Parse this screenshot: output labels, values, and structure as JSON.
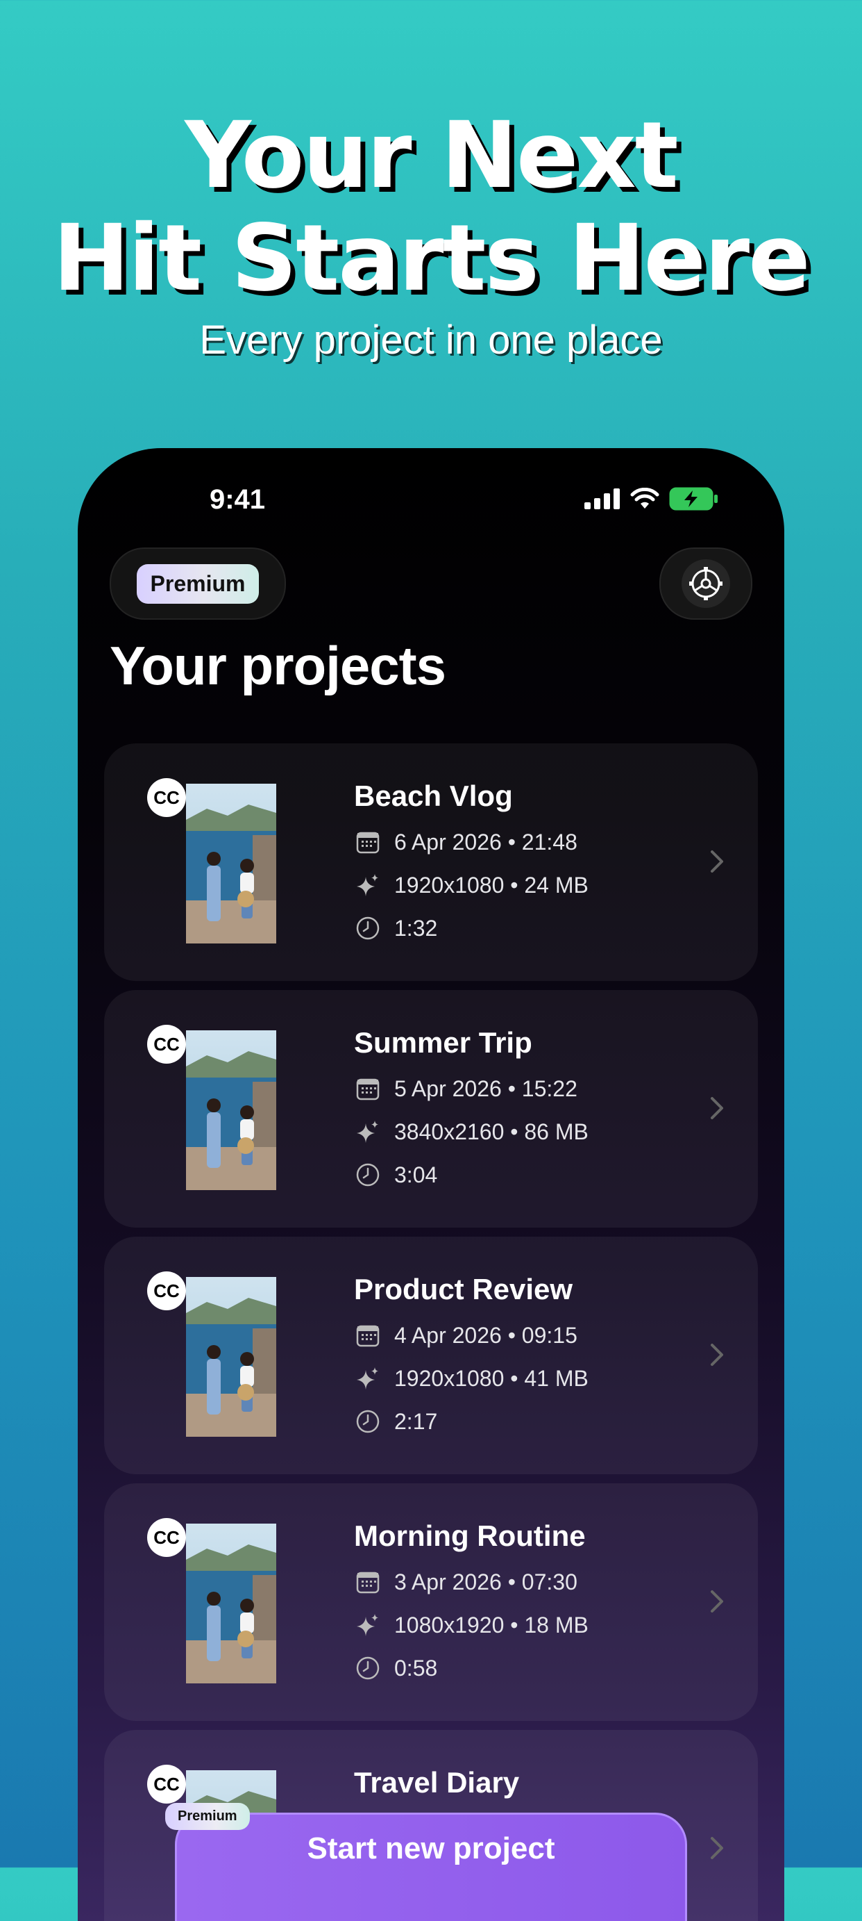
{
  "hero": {
    "title_line1": "Your Next",
    "title_line2": "Hit Starts Here",
    "subtitle": "Every project in one place"
  },
  "status_bar": {
    "time": "9:41",
    "icons": [
      "signal-icon",
      "wifi-icon",
      "battery-charging-icon"
    ]
  },
  "header": {
    "premium_label": "Premium",
    "settings_icon": "gear-icon",
    "title": "Your projects"
  },
  "projects": [
    {
      "badge": "CC",
      "title": "Beach Vlog",
      "date": "6 Apr 2026 • 21:48",
      "specs": "1920x1080 • 24 MB",
      "duration": "1:32"
    },
    {
      "badge": "CC",
      "title": "Summer Trip",
      "date": "5 Apr 2026 • 15:22",
      "specs": "3840x2160 • 86 MB",
      "duration": "3:04"
    },
    {
      "badge": "CC",
      "title": "Product Review",
      "date": "4 Apr 2026 • 09:15",
      "specs": "1920x1080 • 41 MB",
      "duration": "2:17"
    },
    {
      "badge": "CC",
      "title": "Morning Routine",
      "date": "3 Apr 2026 • 07:30",
      "specs": "1080x1920 • 18 MB",
      "duration": "0:58"
    },
    {
      "badge": "CC",
      "title": "Travel Diary"
    }
  ],
  "footer": {
    "premium_badge": "Premium",
    "start_button": "Start new project"
  },
  "colors": {
    "background_top": "#34cbc4",
    "background_bottom": "#1a79b0",
    "button_purple": "#9a68f0",
    "battery_green": "#34c759"
  }
}
